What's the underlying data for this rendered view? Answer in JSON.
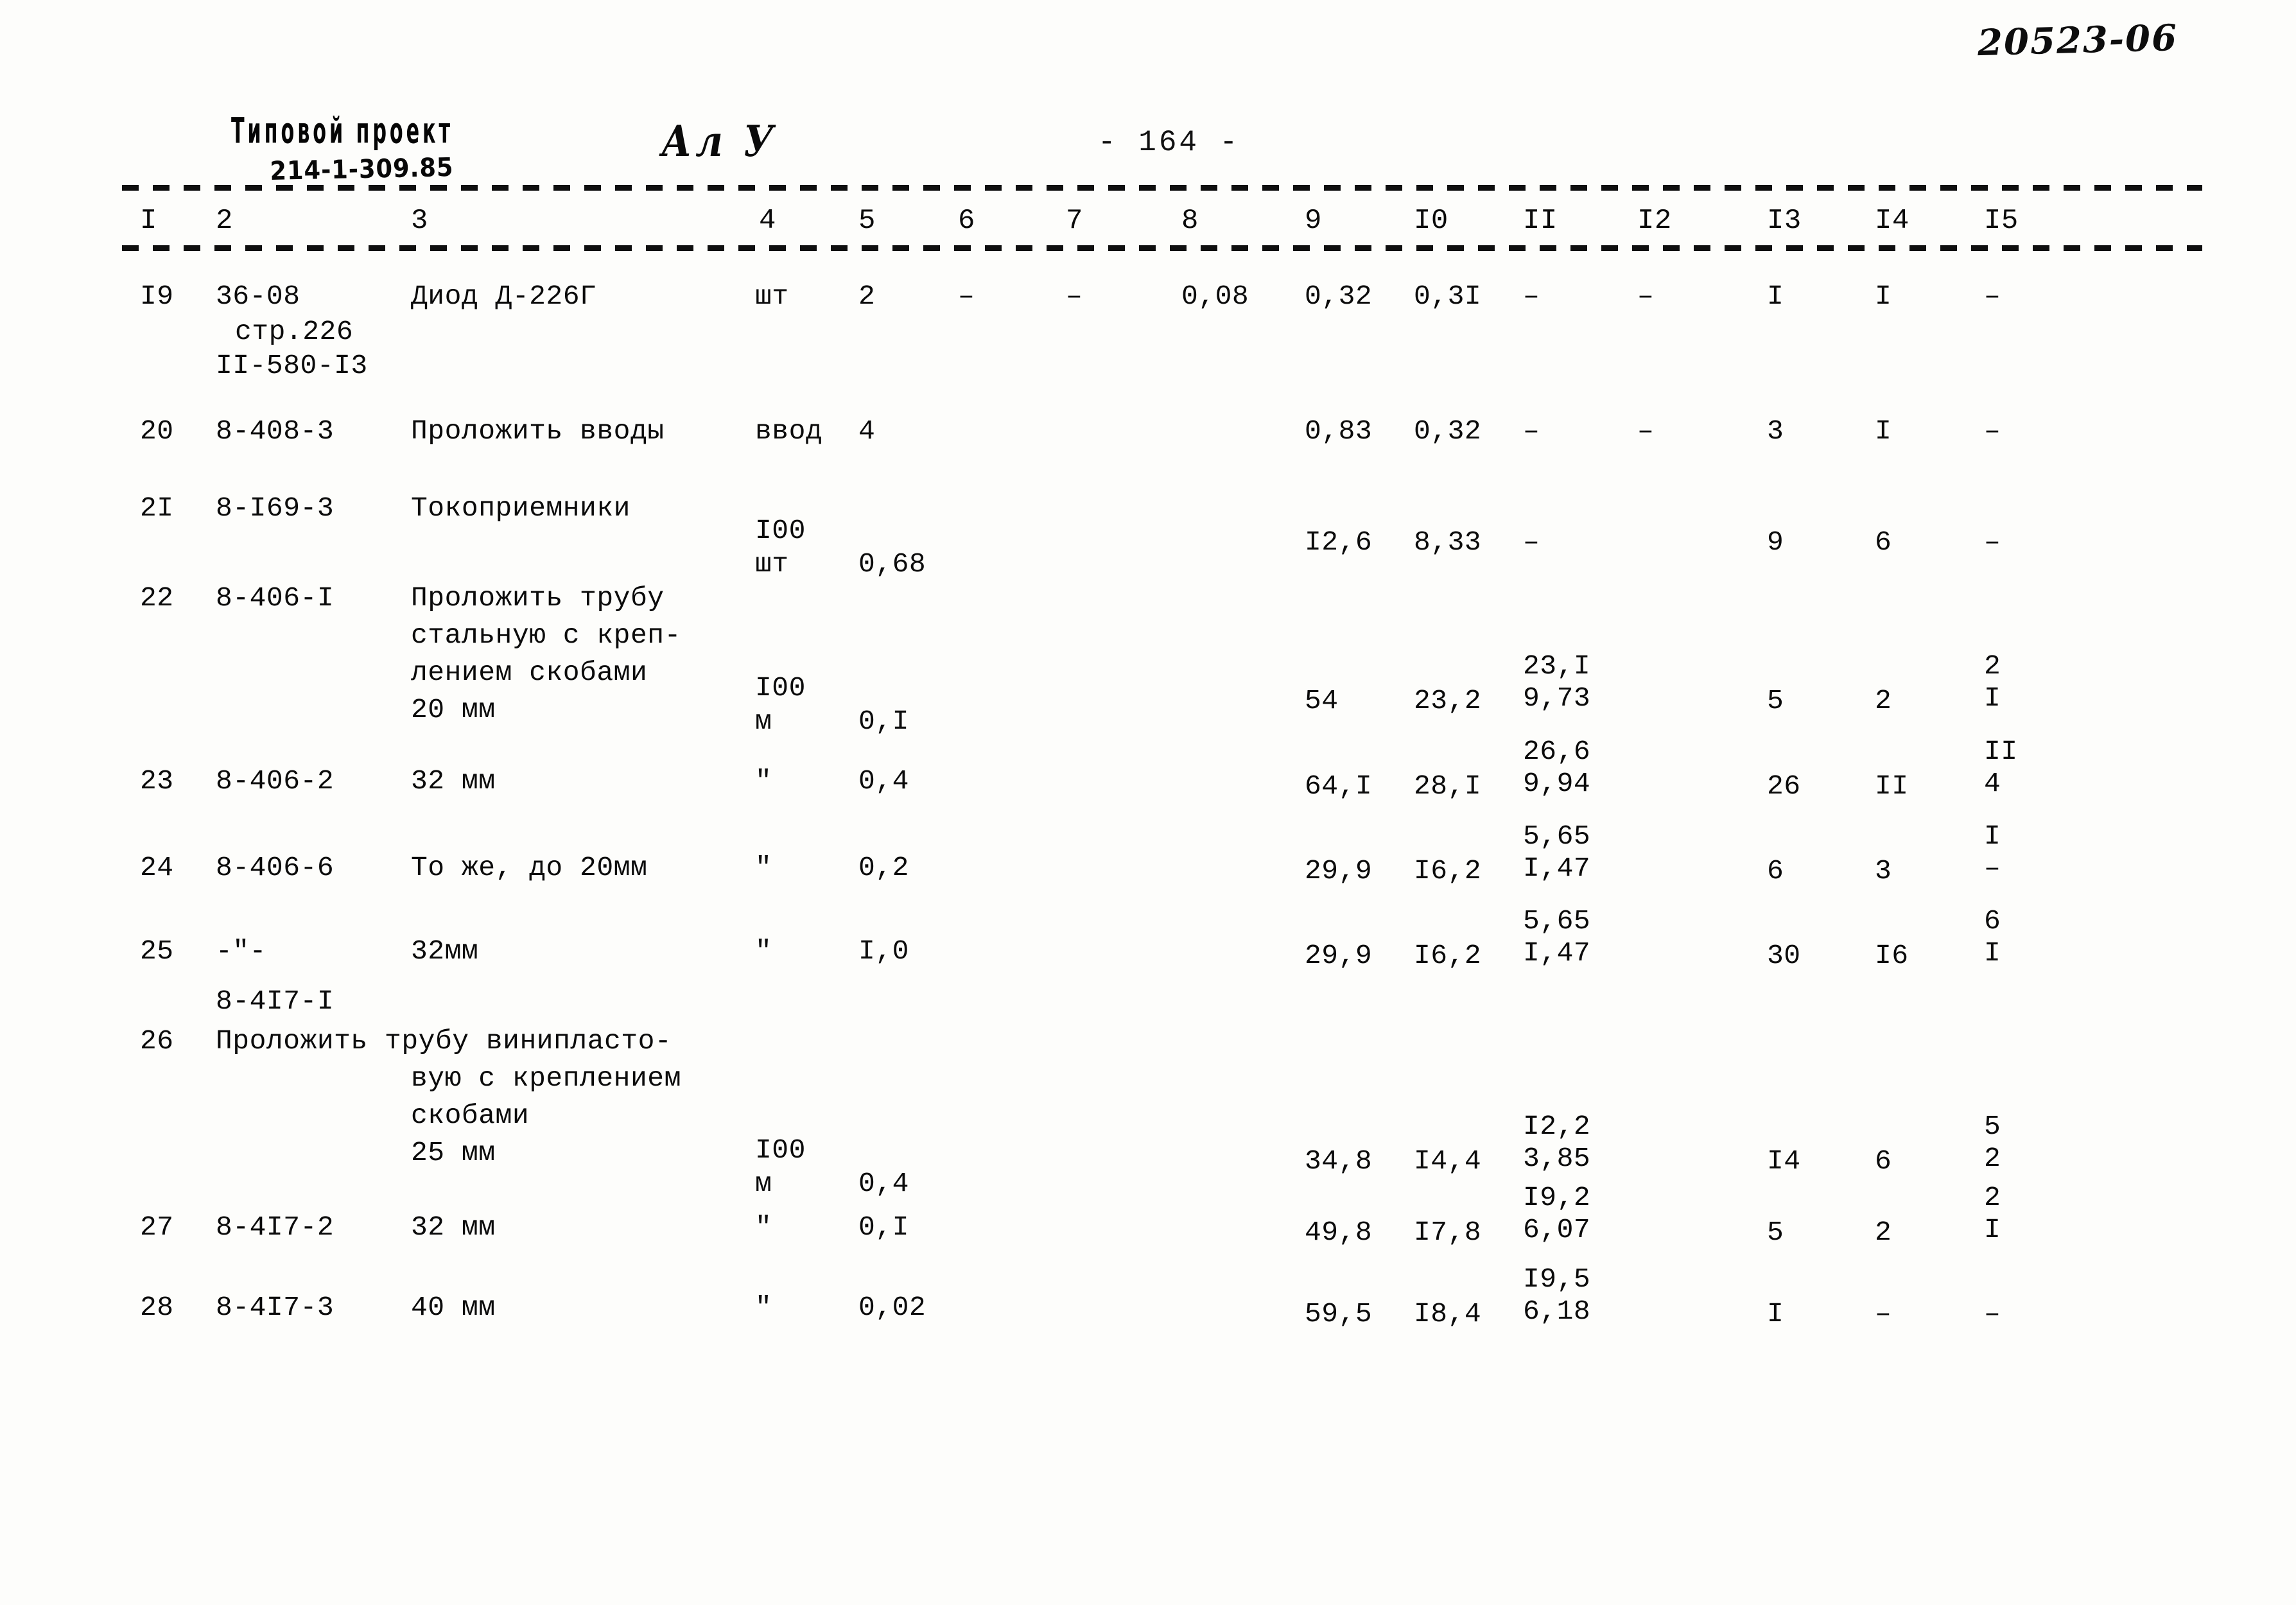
{
  "archive_number": "20523-06",
  "header": {
    "project_label": "Типовой проект",
    "project_code": "214-1-309.85",
    "stamp": "Ал У",
    "page_marker": "- 164 -"
  },
  "table": {
    "column_headers": [
      "I",
      "2",
      "3",
      "4",
      "5",
      "6",
      "7",
      "8",
      "9",
      "I0",
      "II",
      "I2",
      "I3",
      "I4",
      "I5"
    ],
    "rows": [
      {
        "no": "I9",
        "code": "36-08",
        "code2": "стр.226",
        "code3": "II-580-I3",
        "desc": [
          "Диод Д-226Г"
        ],
        "unit": "шт",
        "unit2": "",
        "c5": "2",
        "c6": "–",
        "c7": "–",
        "c8": "0,08",
        "c9": "0,32",
        "c10": "0,3I",
        "c11_top": "",
        "c11": "–",
        "c12": "–",
        "c13": "I",
        "c14": "I",
        "c15_top": "",
        "c15": "–"
      },
      {
        "no": "20",
        "code": "8-408-3",
        "code2": "",
        "code3": "",
        "desc": [
          "Проложить вводы"
        ],
        "unit": "ввод",
        "unit2": "",
        "c5": "4",
        "c6": "",
        "c7": "",
        "c8": "",
        "c9": "0,83",
        "c10": "0,32",
        "c11_top": "",
        "c11": "–",
        "c12": "–",
        "c13": "3",
        "c14": "I",
        "c15_top": "",
        "c15": "–"
      },
      {
        "no": "2I",
        "code": "8-I69-3",
        "code2": "",
        "code3": "",
        "desc": [
          "Токоприемники"
        ],
        "unit": "I00",
        "unit2": "шт",
        "c5": "0,68",
        "c6": "",
        "c7": "",
        "c8": "",
        "c9": "I2,6",
        "c10": "8,33",
        "c11_top": "",
        "c11": "–",
        "c12": "",
        "c13": "9",
        "c14": "6",
        "c15_top": "",
        "c15": "–"
      },
      {
        "no": "22",
        "code": "8-406-I",
        "code2": "",
        "code3": "",
        "desc": [
          "Проложить трубу",
          "стальную с креп-",
          "лением скобами",
          "20 мм"
        ],
        "unit": "I00",
        "unit2": "м",
        "c5": "0,I",
        "c6": "",
        "c7": "",
        "c8": "",
        "c9": "54",
        "c10": "23,2",
        "c11_top": "23,I",
        "c11": "9,73",
        "c12": "",
        "c13": "5",
        "c14": "2",
        "c15_top": "2",
        "c15": "I"
      },
      {
        "no": "23",
        "code": "8-406-2",
        "code2": "",
        "code3": "",
        "desc": [
          "32 мм"
        ],
        "unit": "\"",
        "unit2": "",
        "c5": "0,4",
        "c6": "",
        "c7": "",
        "c8": "",
        "c9": "64,I",
        "c10": "28,I",
        "c11_top": "26,6",
        "c11": "9,94",
        "c12": "",
        "c13": "26",
        "c14": "II",
        "c15_top": "II",
        "c15": "4"
      },
      {
        "no": "24",
        "code": "8-406-6",
        "code2": "",
        "code3": "",
        "desc": [
          "То же, до 20мм"
        ],
        "unit": "\"",
        "unit2": "",
        "c5": "0,2",
        "c6": "",
        "c7": "",
        "c8": "",
        "c9": "29,9",
        "c10": "I6,2",
        "c11_top": "5,65",
        "c11": "I,47",
        "c12": "",
        "c13": "6",
        "c14": "3",
        "c15_top": "I",
        "c15": "–"
      },
      {
        "no": "25",
        "code": "-\"-",
        "code2": "",
        "code3": "",
        "desc": [
          "32мм"
        ],
        "unit": "\"",
        "unit2": "",
        "c5": "I,0",
        "c6": "",
        "c7": "",
        "c8": "",
        "c9": "29,9",
        "c10": "I6,2",
        "c11_top": "5,65",
        "c11": "I,47",
        "c12": "",
        "c13": "30",
        "c14": "I6",
        "c15_top": "6",
        "c15": "I"
      },
      {
        "no": "26",
        "code": "8-4I7-I",
        "code2": "",
        "code3": "",
        "desc": [
          "Проложить трубу винипласто-",
          "вую с креплением",
          "скобами",
          "25 мм"
        ],
        "unit": "I00",
        "unit2": "м",
        "c5": "0,4",
        "c6": "",
        "c7": "",
        "c8": "",
        "c9": "34,8",
        "c10": "I4,4",
        "c11_top": "I2,2",
        "c11": "3,85",
        "c12": "",
        "c13": "I4",
        "c14": "6",
        "c15_top": "5",
        "c15": "2"
      },
      {
        "no": "27",
        "code": "8-4I7-2",
        "code2": "",
        "code3": "",
        "desc": [
          "32 мм"
        ],
        "unit": "\"",
        "unit2": "",
        "c5": "0,I",
        "c6": "",
        "c7": "",
        "c8": "",
        "c9": "49,8",
        "c10": "I7,8",
        "c11_top": "I9,2",
        "c11": "6,07",
        "c12": "",
        "c13": "5",
        "c14": "2",
        "c15_top": "2",
        "c15": "I"
      },
      {
        "no": "28",
        "code": "8-4I7-3",
        "code2": "",
        "code3": "",
        "desc": [
          "40 мм"
        ],
        "unit": "\"",
        "unit2": "",
        "c5": "0,02",
        "c6": "",
        "c7": "",
        "c8": "",
        "c9": "59,5",
        "c10": "I8,4",
        "c11_top": "I9,5",
        "c11": "6,18",
        "c12": "",
        "c13": "I",
        "c14": "–",
        "c15_top": "",
        "c15": "–"
      }
    ]
  }
}
